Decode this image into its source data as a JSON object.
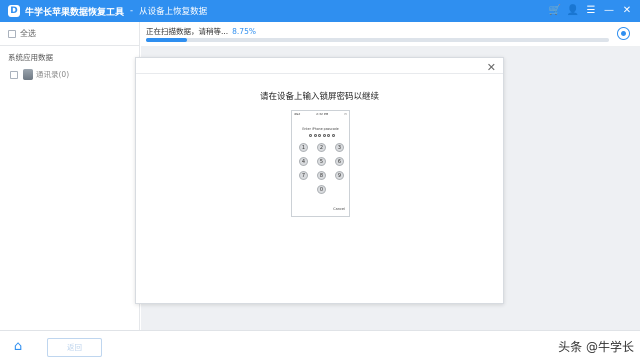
{
  "app": {
    "title": "牛学长苹果数据恢复工具",
    "separator": "-",
    "subtitle": "从设备上恢复数据",
    "logo_letter": "D"
  },
  "title_icons": [
    "cart-icon",
    "user-icon",
    "menu-icon",
    "minimize-icon",
    "close-icon"
  ],
  "sidebar": {
    "select_all_label": "全选",
    "section_title": "系统应用数据",
    "items": [
      {
        "label": "通讯录(0)"
      }
    ]
  },
  "scan": {
    "status_text": "正在扫描数据，请稍等...",
    "percent_text": "8.75%",
    "progress": 0.0875
  },
  "dialog": {
    "message": "请在设备上输入锁屏密码以继续",
    "phone": {
      "carrier": "iPad",
      "time": "2:32 PM",
      "prompt": "Enter iPhone passcode",
      "keys": [
        "1",
        "2",
        "3",
        "4",
        "5",
        "6",
        "7",
        "8",
        "9",
        "0"
      ],
      "cancel": "Cancel"
    }
  },
  "footer": {
    "back_label": "返回",
    "watermark": "头条 @牛学长"
  },
  "colors": {
    "accent": "#2f8ff0",
    "cart": "#ffd84a",
    "content_bg": "#eef0f3"
  }
}
